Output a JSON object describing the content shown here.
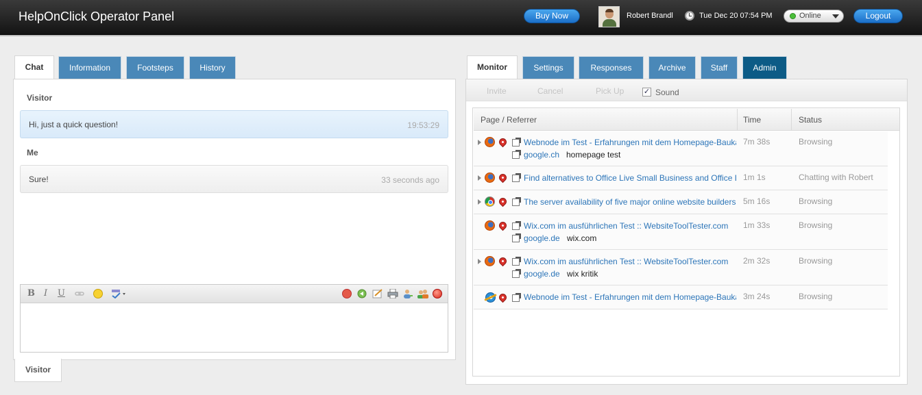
{
  "header": {
    "title": "HelpOnClick Operator Panel",
    "buy_label": "Buy Now",
    "user_name": "Robert Brandl",
    "datetime": "Tue Dec 20 07:54 PM",
    "status": "Online",
    "logout_label": "Logout"
  },
  "left_tabs": [
    "Chat",
    "Information",
    "Footsteps",
    "History"
  ],
  "chat": {
    "messages": [
      {
        "sender": "Visitor",
        "text": "Hi, just a quick question!",
        "time": "19:53:29"
      },
      {
        "sender": "Me",
        "text": "Sure!",
        "time": "33 seconds ago"
      }
    ],
    "toolbar_icons": [
      "bold-icon",
      "italic-icon",
      "underline-icon",
      "link-icon",
      "smiley-icon",
      "spellcheck-icon",
      "block-icon",
      "transfer-icon",
      "note-icon",
      "print-icon",
      "user-icon",
      "users-icon",
      "end-chat-icon"
    ],
    "toolbar_labels": {
      "bold": "B",
      "italic": "I",
      "underline": "U"
    },
    "bottom_tab": "Visitor"
  },
  "right_tabs": [
    "Monitor",
    "Settings",
    "Responses",
    "Archive",
    "Staff",
    "Admin"
  ],
  "monitor": {
    "actions": [
      "Invite",
      "Cancel",
      "Pick Up"
    ],
    "sound_label": "Sound",
    "sound_checked": true,
    "sound_mark": "✓",
    "columns": [
      "Page / Referrer",
      "Time",
      "Status"
    ],
    "rows": [
      {
        "browser": "firefox",
        "expandable": true,
        "page": "Webnode im Test - Erfahrungen mit dem Homepage-Baukasten",
        "referrer": "google.ch",
        "search_term": "homepage test",
        "time": "7m 38s",
        "status": "Browsing"
      },
      {
        "browser": "firefox",
        "expandable": true,
        "page": "Find alternatives to Office Live Small Business and Office Live",
        "referrer": "",
        "search_term": "",
        "time": "1m 1s",
        "status": "Chatting with Robert"
      },
      {
        "browser": "chrome",
        "expandable": true,
        "page": "The server availability of five major online website builders",
        "referrer": "",
        "search_term": "",
        "time": "5m 16s",
        "status": "Browsing"
      },
      {
        "browser": "firefox",
        "expandable": false,
        "page": "Wix.com im ausführlichen Test :: WebsiteToolTester.com",
        "referrer": "google.de",
        "search_term": "wix.com",
        "time": "1m 33s",
        "status": "Browsing"
      },
      {
        "browser": "firefox",
        "expandable": true,
        "page": "Wix.com im ausführlichen Test :: WebsiteToolTester.com",
        "referrer": "google.de",
        "search_term": "wix kritik",
        "time": "2m 32s",
        "status": "Browsing"
      },
      {
        "browser": "ie",
        "expandable": false,
        "page": "Webnode im Test - Erfahrungen mit dem Homepage-Baukasten",
        "referrer": "",
        "search_term": "",
        "time": "3m 24s",
        "status": "Browsing"
      }
    ]
  },
  "colors": {
    "tab_blue": "#4a88b8",
    "tab_dark": "#0c5b86",
    "link": "#2c75b8",
    "button_blue": "#1b6fc8"
  }
}
